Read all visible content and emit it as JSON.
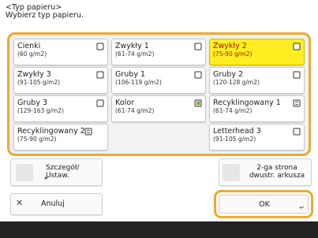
{
  "header": {
    "title": "<Typ papieru>",
    "instruction": "Wybierz typ papieru."
  },
  "paper_types": [
    {
      "name": "Cienki",
      "range": "(60 g/m2)",
      "selected": false,
      "tray_icon": "tray-icon"
    },
    {
      "name": "Zwykły 1",
      "range": "(61-74 g/m2)",
      "selected": false,
      "tray_icon": "tray-icon"
    },
    {
      "name": "Zwykły 2",
      "range": "(75-90 g/m2)",
      "selected": true,
      "tray_icon": "tray-icon"
    },
    {
      "name": "Zwykły 3",
      "range": "(91-105 g/m2)",
      "selected": false,
      "tray_icon": "tray-icon"
    },
    {
      "name": "Gruby 1",
      "range": "(106-119 g/m2)",
      "selected": false,
      "tray_icon": "tray-icon"
    },
    {
      "name": "Gruby 2",
      "range": "(120-128 g/m2)",
      "selected": false,
      "tray_icon": "tray-icon"
    },
    {
      "name": "Gruby 3",
      "range": "(129-163 g/m2)",
      "selected": false,
      "tray_icon": "tray-icon"
    },
    {
      "name": "Kolor",
      "range": "(61-74 g/m2)",
      "selected": false,
      "tray_icon": "color-tray-icon"
    },
    {
      "name": "Recyklingowany 1",
      "range": "(61-74 g/m2)",
      "selected": false,
      "tray_icon": "recycled-icon"
    },
    {
      "name": "Recyklingowany 2",
      "range": "(75-90 g/m2)",
      "selected": false,
      "tray_icon": "recycled-icon"
    },
    {
      "name": "Letterhead 3",
      "range": "(91-105 g/m2)",
      "selected": false,
      "tray_icon": "tray-icon"
    }
  ],
  "buttons": {
    "details": "Szczegół/ Ustaw.",
    "second_side": "2-ga strona dwustr. arkusza",
    "cancel": "Anuluj",
    "ok": "OK"
  },
  "colors": {
    "accent": "#f0a830",
    "selected_bg": "#ffee22",
    "selected_text": "#b01010"
  }
}
